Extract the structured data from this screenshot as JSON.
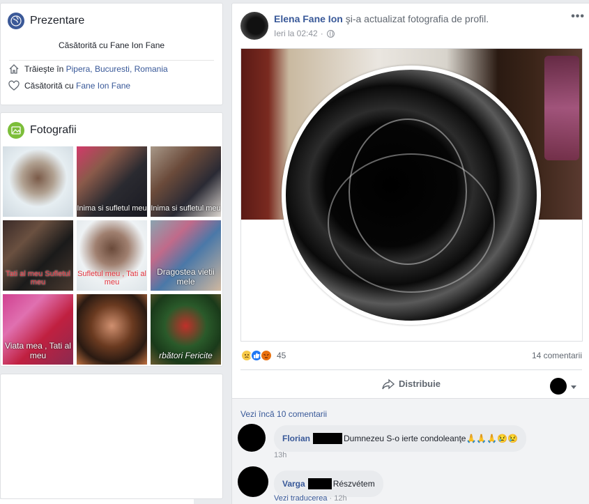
{
  "intro": {
    "title": "Prezentare",
    "bio": "Căsătorită cu Fane Ion Fane",
    "lives_prefix": "Trăieşte în",
    "lives_place": "Pipera, Bucuresti, Romania",
    "married_prefix": "Căsătorită cu",
    "married_name": "Fane Ion Fane",
    "icon": "globe-icon"
  },
  "photos": {
    "title": "Fotografii",
    "icon": "photos-icon",
    "items": [
      {
        "caption": ""
      },
      {
        "caption": "Inima si sufletul meu"
      },
      {
        "caption": "Inima si sufletul meu"
      },
      {
        "caption": "Tati al meu Sufletul meu"
      },
      {
        "caption": "Sufletul meu , Tati al meu"
      },
      {
        "caption": "Dragostea vietii mele"
      },
      {
        "caption": "Viata mea , Tati al meu"
      },
      {
        "caption": ""
      },
      {
        "caption": "rbători Fericite"
      }
    ]
  },
  "post": {
    "author": "Elena Fane Ion",
    "action": "şi-a actualizat fotografia de profil.",
    "time": "Ieri la 02:42",
    "more": "•••",
    "reaction_count": "45",
    "comments_count": "14 comentarii",
    "share_label": "Distribuie",
    "view_more": "Vezi încă 10 comentarii"
  },
  "comments": [
    {
      "name": "Florian",
      "text": "Dumnezeu S-o ierte condoleanţe🙏🙏🙏😢😢",
      "meta_time": "13h",
      "meta_link": ""
    },
    {
      "name": "Varga",
      "text": "Részvétem",
      "meta_time": "12h",
      "meta_link": "Vezi traducerea"
    }
  ],
  "colors": {
    "link": "#385898",
    "background": "#e9ebee",
    "like": "#2078f4",
    "sad": "#f7c948",
    "angry": "#e9710f"
  }
}
